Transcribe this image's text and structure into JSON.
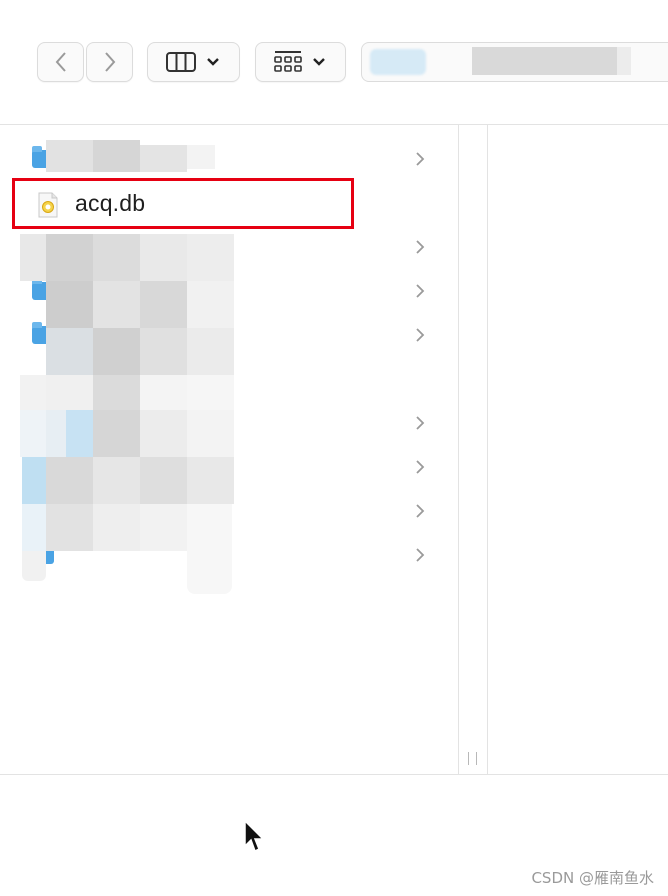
{
  "toolbar": {
    "back_icon": "chevron-left-icon",
    "forward_icon": "chevron-right-icon",
    "view_icon": "columns-icon",
    "group_icon": "grid-icon",
    "dropdown_icon": "chevron-down-icon"
  },
  "columns": {
    "selected_file": {
      "name": "acq.db",
      "icon": "database-file-icon"
    },
    "rows_with_chevrons": 7
  },
  "colors": {
    "highlight": "#e60012",
    "folder": "#4aa3e4"
  },
  "watermark": "CSDN @雁南鱼水"
}
